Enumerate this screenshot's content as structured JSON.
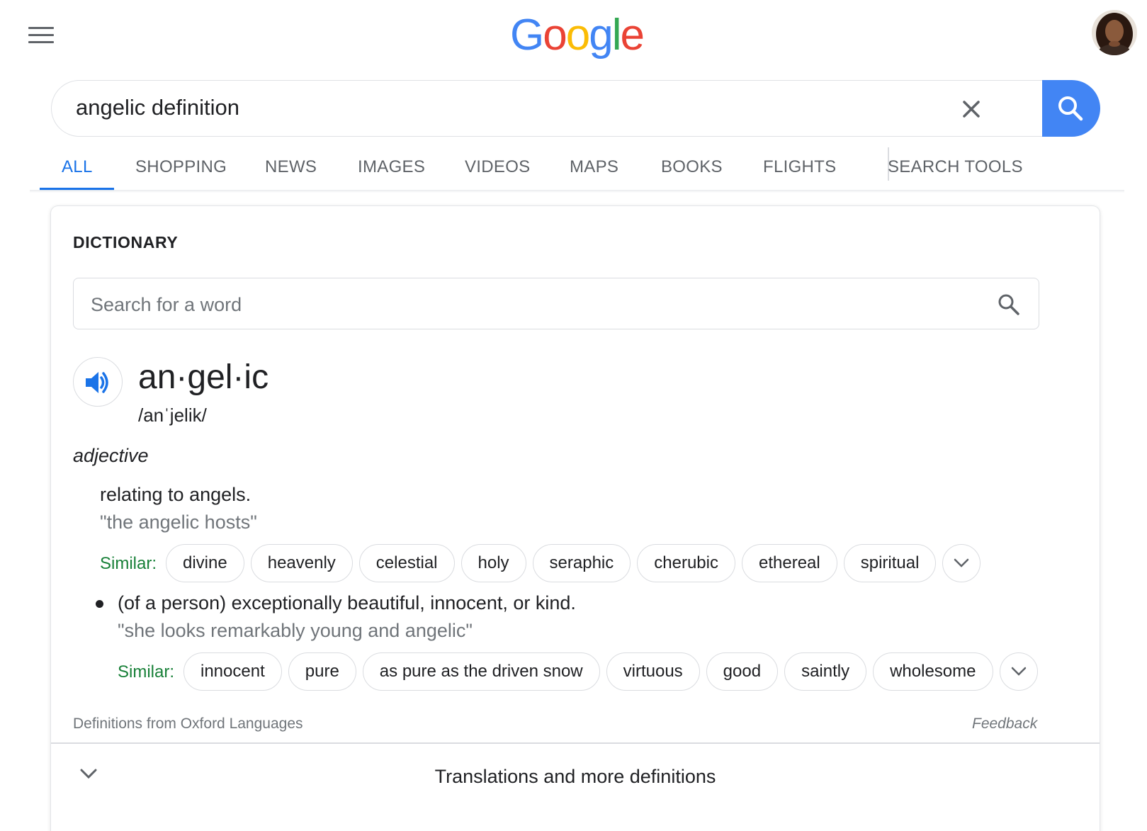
{
  "header": {
    "logo_letters": [
      "G",
      "o",
      "o",
      "g",
      "l",
      "e"
    ],
    "logo_colors": [
      "#4285f4",
      "#ea4335",
      "#fbbc05",
      "#4285f4",
      "#34a853",
      "#ea4335"
    ],
    "menu_icon": "hamburger-menu-icon",
    "avatar": "user-avatar"
  },
  "search": {
    "query": "angelic definition",
    "clear_icon": "close-icon",
    "submit_icon": "search-icon",
    "accent": "#4285f4"
  },
  "tabs": [
    {
      "label": "ALL",
      "active": true
    },
    {
      "label": "SHOPPING",
      "active": false
    },
    {
      "label": "NEWS",
      "active": false
    },
    {
      "label": "IMAGES",
      "active": false
    },
    {
      "label": "VIDEOS",
      "active": false
    },
    {
      "label": "MAPS",
      "active": false
    },
    {
      "label": "BOOKS",
      "active": false
    },
    {
      "label": "FLIGHTS",
      "active": false
    },
    {
      "label": "SEARCH TOOLS",
      "active": false
    }
  ],
  "dictionary": {
    "title": "DICTIONARY",
    "search_placeholder": "Search for a word",
    "headword": "an·gel·ic",
    "phonetic": "/anˈjelik/",
    "part_of_speech": "adjective",
    "senses": [
      {
        "definition": "relating to angels.",
        "example": "\"the angelic hosts\"",
        "similar_label": "Similar:",
        "similar": [
          "divine",
          "heavenly",
          "celestial",
          "holy",
          "seraphic",
          "cherubic",
          "ethereal",
          "spiritual"
        ]
      },
      {
        "definition": "(of a person) exceptionally beautiful, innocent, or kind.",
        "example": "\"she looks remarkably young and angelic\"",
        "similar_label": "Similar:",
        "similar": [
          "innocent",
          "pure",
          "as pure as the driven snow",
          "virtuous",
          "good",
          "saintly",
          "wholesome"
        ]
      }
    ],
    "source": "Definitions from Oxford Languages",
    "feedback": "Feedback",
    "more": "Translations and more definitions",
    "similar_color": "#188038"
  }
}
